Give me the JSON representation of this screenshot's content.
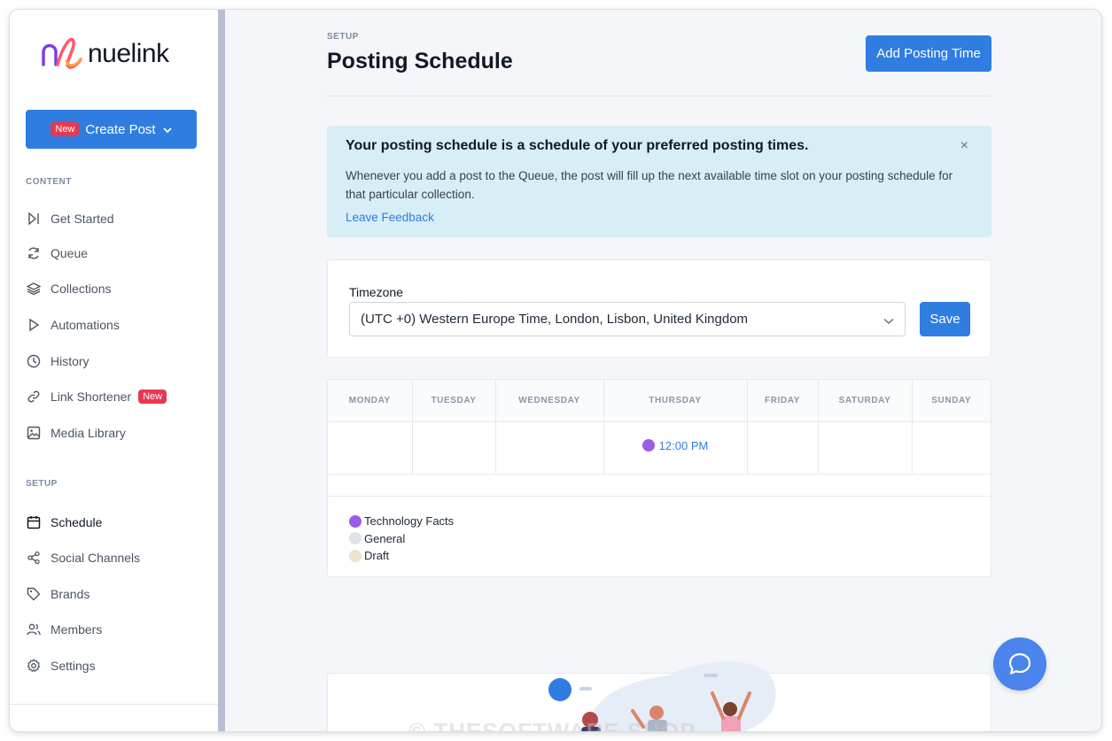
{
  "brand": {
    "name": "nuelink"
  },
  "sidebar": {
    "create_post": {
      "badge": "New",
      "label": "Create Post"
    },
    "content_label": "CONTENT",
    "content_items": [
      {
        "label": "Get Started",
        "icon": "skip-forward-icon"
      },
      {
        "label": "Queue",
        "icon": "refresh-icon"
      },
      {
        "label": "Collections",
        "icon": "layers-icon"
      },
      {
        "label": "Automations",
        "icon": "play-icon"
      },
      {
        "label": "History",
        "icon": "clock-icon"
      },
      {
        "label": "Link Shortener",
        "icon": "link-icon",
        "badge": "New"
      },
      {
        "label": "Media Library",
        "icon": "image-icon"
      }
    ],
    "setup_label": "SETUP",
    "setup_items": [
      {
        "label": "Schedule",
        "icon": "calendar-icon",
        "active": true
      },
      {
        "label": "Social Channels",
        "icon": "share-icon"
      },
      {
        "label": "Brands",
        "icon": "tag-icon"
      },
      {
        "label": "Members",
        "icon": "users-icon"
      },
      {
        "label": "Settings",
        "icon": "gear-icon"
      }
    ]
  },
  "header": {
    "crumb": "SETUP",
    "title": "Posting Schedule",
    "add_button": "Add Posting Time"
  },
  "alert": {
    "title": "Your posting schedule is a schedule of your preferred posting times.",
    "close": "×",
    "body": "Whenever you add a post to the Queue, the post will fill up the next available time slot on your posting schedule for that particular collection.",
    "link": "Leave Feedback"
  },
  "timezone": {
    "label": "Timezone",
    "selected": "(UTC +0) Western Europe Time, London, Lisbon, United Kingdom",
    "save": "Save"
  },
  "schedule": {
    "days": [
      "MONDAY",
      "TUESDAY",
      "WEDNESDAY",
      "THURSDAY",
      "FRIDAY",
      "SATURDAY",
      "SUNDAY"
    ],
    "slots": [
      {
        "day": "THURSDAY",
        "time": "12:00 PM",
        "color": "#9b5de5"
      }
    ]
  },
  "legend": [
    {
      "label": "Technology Facts",
      "color": "#9b5de5"
    },
    {
      "label": "General",
      "color": "#dde3e8"
    },
    {
      "label": "Draft",
      "color": "#efe3cf"
    }
  ],
  "colors": {
    "accent": "#2f7de1",
    "alert_bg": "#d8eef6",
    "badge_red": "#e8384f"
  },
  "watermark": "© THESOFTWARE SHOP"
}
